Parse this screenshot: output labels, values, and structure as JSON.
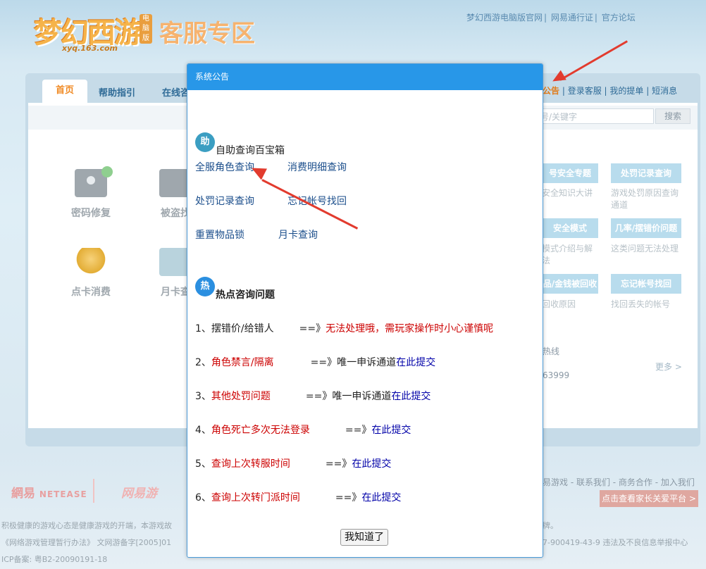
{
  "header": {
    "logo_text": "梦幻西游",
    "logo_sub": "xyq.163.com",
    "logo_badge": "电脑版",
    "site_title": "客服专区",
    "top_links": [
      "梦幻西游电脑版官网",
      "网易通行证",
      "官方论坛"
    ]
  },
  "nav": {
    "tabs": [
      "首页",
      "帮助指引",
      "在线咨"
    ],
    "right_links": [
      "公告",
      "登录客服",
      "我的提单",
      "短消息"
    ]
  },
  "search": {
    "placeholder": "号/关键字",
    "button": "搜索"
  },
  "services": [
    "密码修复",
    "被盗找",
    "点卡消费",
    "月卡查"
  ],
  "side_pills": [
    {
      "title": "号安全专题",
      "desc": "安全知识大讲"
    },
    {
      "title": "处罚记录查询",
      "desc": "游戏处罚原因查询通道"
    },
    {
      "title": "安全模式",
      "desc": "模式介绍与解法"
    },
    {
      "title": "几率/摆错价问题",
      "desc": "这类问题无法处理"
    },
    {
      "title": "品/金钱被回收",
      "desc": "回收原因"
    },
    {
      "title": "忘记帐号找回",
      "desc": "找回丢失的帐号"
    }
  ],
  "hotline": {
    "label": "热线",
    "number": "63999",
    "more": "更多 >"
  },
  "footer": {
    "netease": "網易",
    "netease_en": "NETEASE",
    "brand_163": "网易游",
    "links": "易游戏 - 联系我们 - 商务合作 - 加入我们",
    "parental": "点击查看家长关爱平台 >",
    "line1": "积极健康的游戏心态是健康游戏的开端，本游戏故",
    "line1_right": "牌。",
    "line2": "《网络游戏管理暂行办法》 文网游备字[2005]01",
    "line2_right": "7-900419-43-9 违法及不良信息举报中心",
    "line3": "ICP备案: 粤B2-20090191-18"
  },
  "dialog": {
    "title": "系统公告",
    "help_badge": "助",
    "help_title": "自助查询百宝箱",
    "help_links": [
      "全服角色查询",
      "消费明细查询",
      "处罚记录查询",
      "忘记帐号找回",
      "重置物品锁",
      "月卡查询"
    ],
    "hot_badge": "热",
    "hot_title": "热点咨询问题",
    "faq": [
      {
        "num": "1、",
        "q": "摆错价/给错人",
        "arrow": "==》",
        "a": "无法处理哦，需玩家操作时小心谨慎呢",
        "link": ""
      },
      {
        "num": "2、",
        "q": "角色禁言/隔离",
        "arrow": "==》",
        "a": "唯一申诉通道",
        "link": "在此提交"
      },
      {
        "num": "3、",
        "q": "其他处罚问题",
        "arrow": "==》",
        "a": "唯一申诉通道",
        "link": "在此提交"
      },
      {
        "num": "4、",
        "q": "角色死亡多次无法登录",
        "arrow": "==》",
        "a": "",
        "link": "在此提交"
      },
      {
        "num": "5、",
        "q": "查询上次转服时间",
        "arrow": "==》",
        "a": "",
        "link": "在此提交"
      },
      {
        "num": "6、",
        "q": "查询上次转门派时间",
        "arrow": "==》",
        "a": "",
        "link": "在此提交"
      }
    ],
    "ok_button": "我知道了"
  },
  "colors": {
    "dialog_header": "#2897e8",
    "faq_question": "#cc0000",
    "submit_link": "#0000a8",
    "annotation_arrow": "#e23b2e"
  }
}
